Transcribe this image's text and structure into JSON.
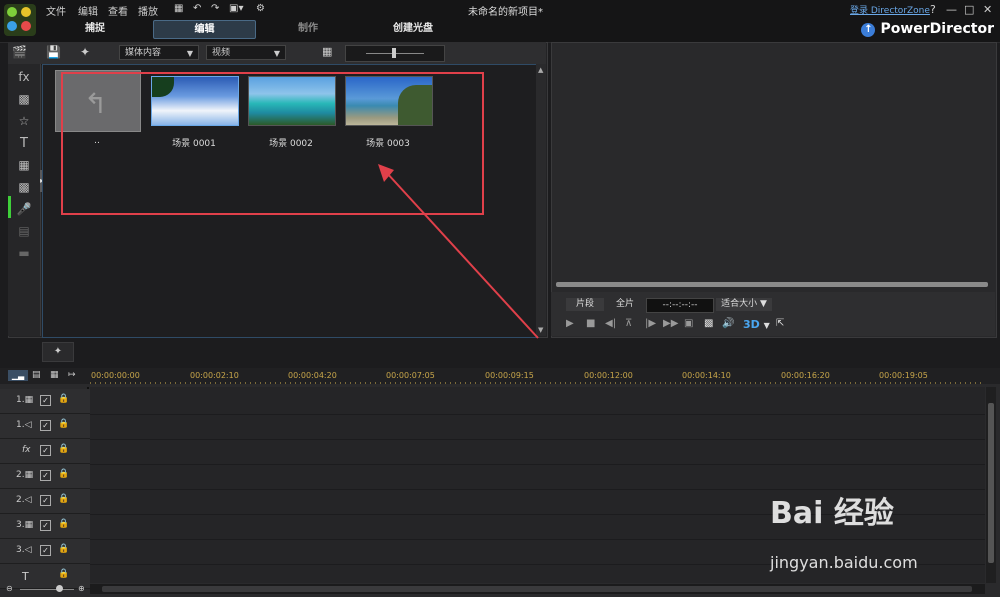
{
  "menu": [
    "文件",
    "编辑",
    "查看",
    "播放"
  ],
  "window_title": "未命名的新项目*",
  "tabs": [
    {
      "label": "捕捉"
    },
    {
      "label": "编辑"
    },
    {
      "label": "制作"
    },
    {
      "label": "创建光盘"
    }
  ],
  "login_link": "登录 DirectorZone",
  "brand": "PowerDirector",
  "library": {
    "dropdown_content": "媒体内容",
    "dropdown_filter": "视频",
    "back_label": "..",
    "items": [
      {
        "label": "场景 0001"
      },
      {
        "label": "场景 0002"
      },
      {
        "label": "场景 0003"
      }
    ]
  },
  "preview": {
    "clip_btn": "片段",
    "full_btn": "全片",
    "timecode": "--:--:--:--",
    "fit_label": "适合大小",
    "mode_3d": "3D"
  },
  "timeline": {
    "ticks": [
      "00:00:00:00",
      "00:00:02:10",
      "00:00:04:20",
      "00:00:07:05",
      "00:00:09:15",
      "00:00:12:00",
      "00:00:14:10",
      "00:00:16:20",
      "00:00:19:05"
    ],
    "tracks": [
      {
        "label": "1."
      },
      {
        "label": "1."
      },
      {
        "label": "fx"
      },
      {
        "label": "2."
      },
      {
        "label": "2."
      },
      {
        "label": "3."
      },
      {
        "label": "3."
      },
      {
        "label": "T"
      }
    ]
  },
  "watermark": {
    "main": "Bai 经验",
    "url": "jingyan.baidu.com"
  },
  "colors": {
    "accent": "#2f4b66",
    "annotation": "#e0404a",
    "timecode_text": "#c8a64a"
  }
}
